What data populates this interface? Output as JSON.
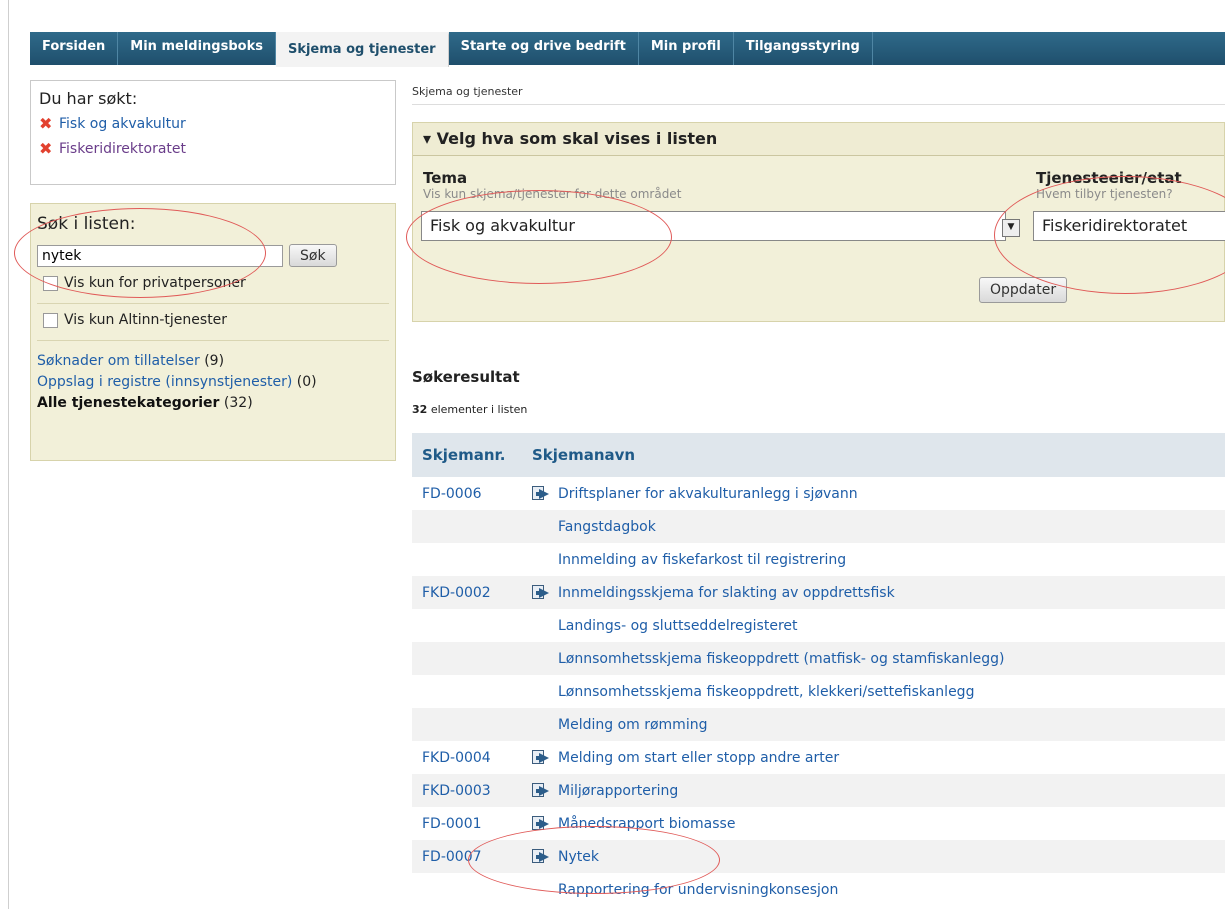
{
  "nav": {
    "tabs": [
      {
        "label": "Forsiden",
        "active": false
      },
      {
        "label": "Min meldingsboks",
        "active": false
      },
      {
        "label": "Skjema og tjenester",
        "active": true
      },
      {
        "label": "Starte og drive bedrift",
        "active": false
      },
      {
        "label": "Min profil",
        "active": false
      },
      {
        "label": "Tilgangsstyring",
        "active": false
      }
    ]
  },
  "searched": {
    "heading": "Du har søkt:",
    "filters": [
      "Fisk og akvakultur",
      "Fiskeridirektoratet"
    ]
  },
  "search": {
    "heading": "Søk i listen:",
    "value": "nytek",
    "button": "Søk",
    "checkbox_private": "Vis kun for privatpersoner",
    "checkbox_altinn": "Vis kun Altinn-tjenester",
    "categories": [
      {
        "label": "Søknader om tillatelser",
        "count": "(9)",
        "bold": false
      },
      {
        "label": "Oppslag i registre (innsynstjenester)",
        "count": "(0)",
        "bold": false
      },
      {
        "label": "Alle tjenestekategorier",
        "count": "(32)",
        "bold": true
      }
    ]
  },
  "breadcrumb": "Skjema og tjenester",
  "filter_panel": {
    "title": "▾ Velg hva som skal vises i listen",
    "tema_label": "Tema",
    "tema_hint": "Vis kun skjema/tjenester for dette området",
    "tema_value": "Fisk og akvakultur",
    "owner_label": "Tjenesteeier/etat",
    "owner_hint": "Hvem tilbyr tjenesten?",
    "owner_value": "Fiskeridirektoratet",
    "update_button": "Oppdater"
  },
  "results": {
    "title": "Søkeresultat",
    "count": "32",
    "count_suffix": "elementer i listen",
    "col_number": "Skjemanr.",
    "col_name": "Skjemanavn",
    "rows": [
      {
        "number": "FD-0006",
        "icon": true,
        "name": "Driftsplaner for akvakulturanlegg i sjøvann"
      },
      {
        "number": "",
        "icon": false,
        "name": "Fangstdagbok"
      },
      {
        "number": "",
        "icon": false,
        "name": "Innmelding av fiskefarkost til registrering"
      },
      {
        "number": "FKD-0002",
        "icon": true,
        "name": "Innmeldingsskjema for slakting av oppdrettsfisk"
      },
      {
        "number": "",
        "icon": false,
        "name": "Landings- og sluttseddelregisteret"
      },
      {
        "number": "",
        "icon": false,
        "name": "Lønnsomhetsskjema fiskeoppdrett (matfisk- og stamfiskanlegg)"
      },
      {
        "number": "",
        "icon": false,
        "name": "Lønnsomhetsskjema fiskeoppdrett, klekkeri/settefiskanlegg"
      },
      {
        "number": "",
        "icon": false,
        "name": "Melding om rømming"
      },
      {
        "number": "FKD-0004",
        "icon": true,
        "name": "Melding om start eller stopp andre arter"
      },
      {
        "number": "FKD-0003",
        "icon": true,
        "name": "Miljørapportering"
      },
      {
        "number": "FD-0001",
        "icon": true,
        "name": "Månedsrapport biomasse"
      },
      {
        "number": "FD-0007",
        "icon": true,
        "name": "Nytek"
      },
      {
        "number": "",
        "icon": false,
        "name": "Rapportering for undervisningkonsesjon"
      }
    ]
  },
  "colors": {
    "nav": "#1f4f6c",
    "link": "#1f5ea8",
    "panel": "#f2f0d9",
    "annotation": "#e05a58"
  }
}
